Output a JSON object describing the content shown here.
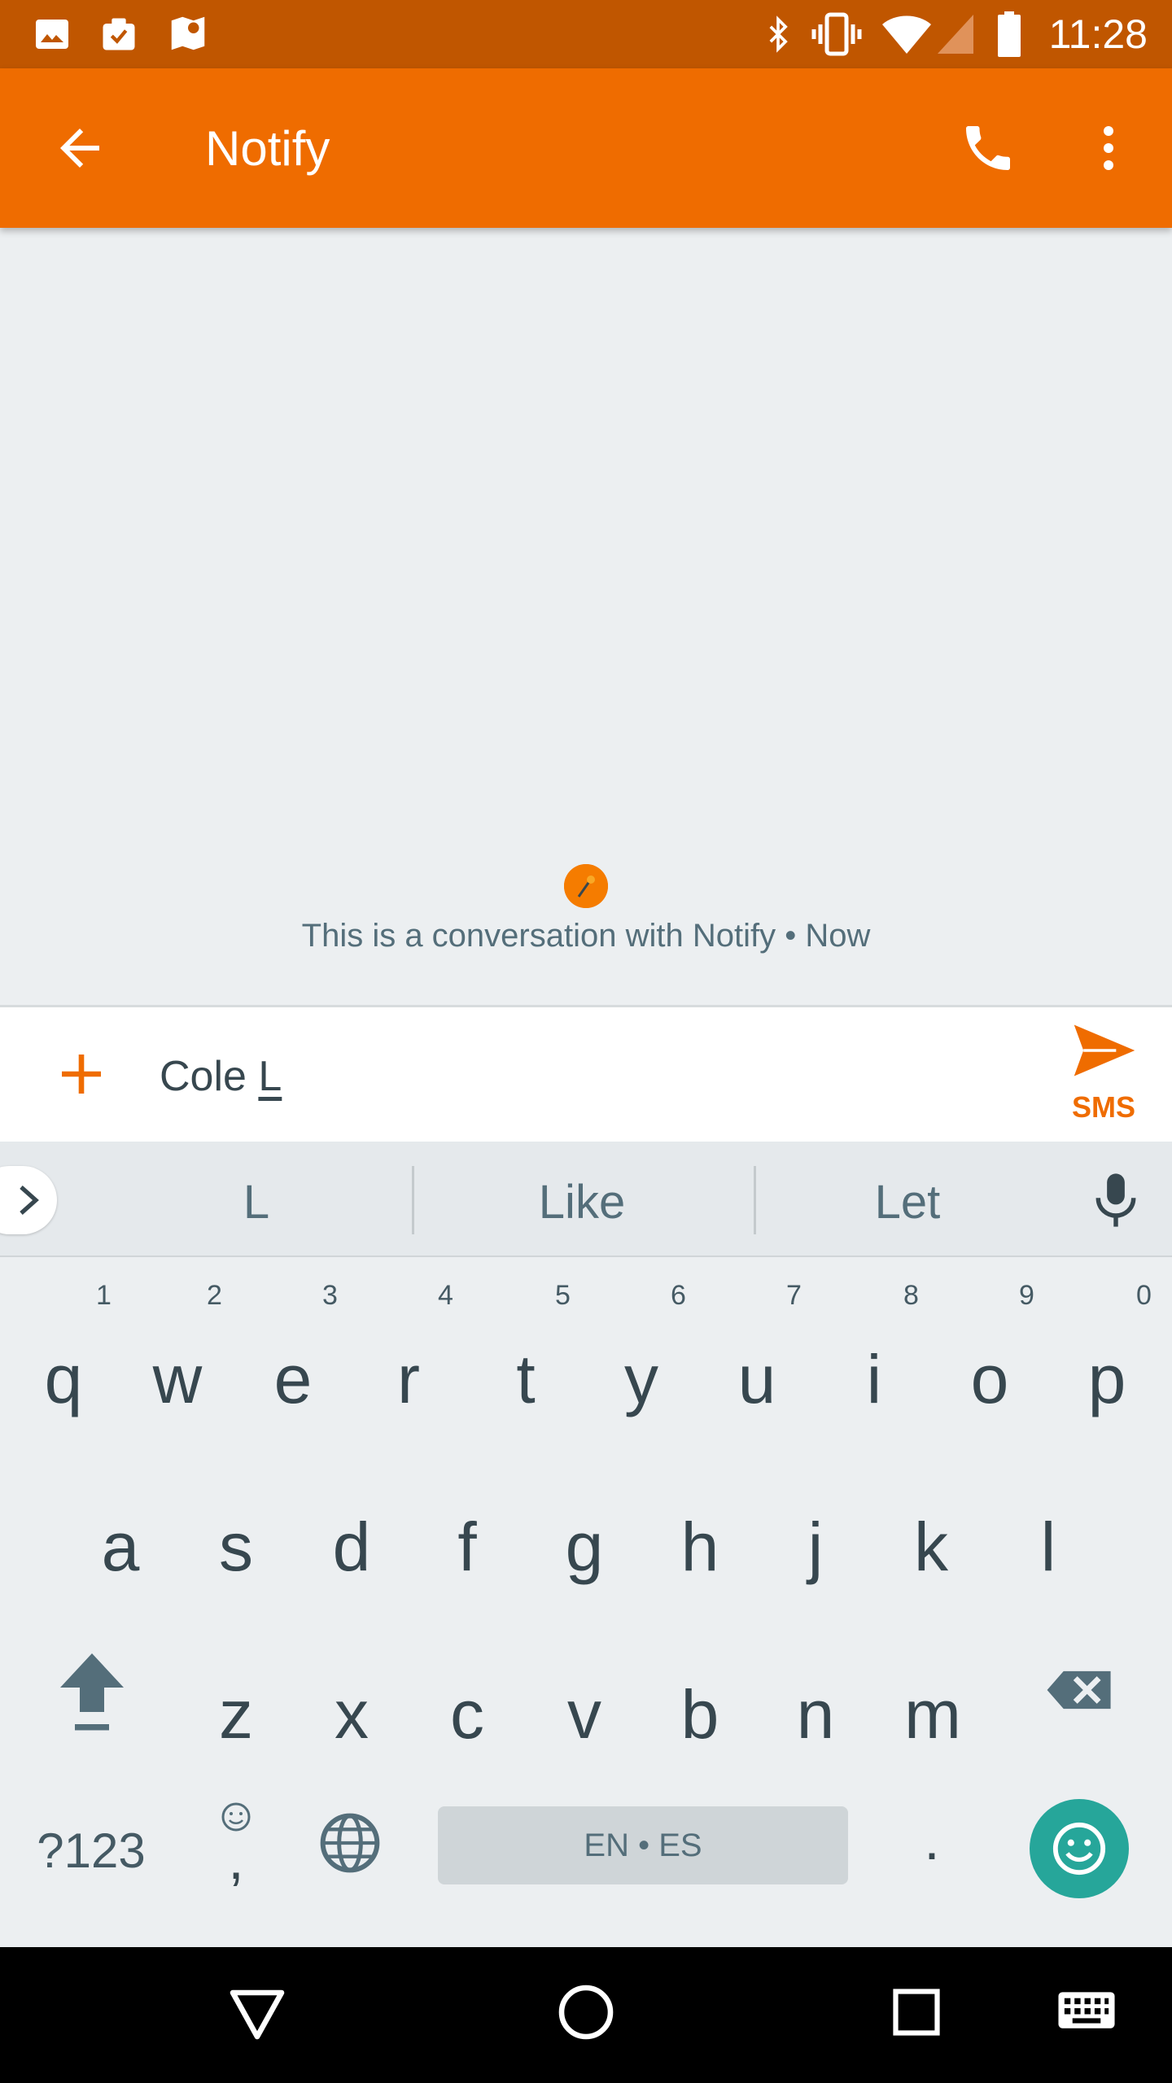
{
  "status_bar": {
    "time": "11:28",
    "left_icons": [
      "image-icon",
      "task-icon",
      "map-icon"
    ],
    "right_icons": [
      "bluetooth-icon",
      "vibrate-icon",
      "wifi-icon",
      "signal-icon",
      "battery-icon"
    ]
  },
  "app_bar": {
    "title": "Notify",
    "back_icon": "arrow-left-icon",
    "call_icon": "phone-icon",
    "menu_icon": "more-vert-icon",
    "color": "#ef6c00"
  },
  "conversation": {
    "info": "This is a conversation with Notify • Now"
  },
  "compose": {
    "text_prefix": "Cole ",
    "text_composing": "L",
    "send_label": "SMS",
    "accent": "#ef6c00"
  },
  "suggestions": [
    "L",
    "Like",
    "Let"
  ],
  "keyboard": {
    "row1": [
      "q",
      "w",
      "e",
      "r",
      "t",
      "y",
      "u",
      "i",
      "o",
      "p"
    ],
    "row1_hints": [
      "1",
      "2",
      "3",
      "4",
      "5",
      "6",
      "7",
      "8",
      "9",
      "0"
    ],
    "row2": [
      "a",
      "s",
      "d",
      "f",
      "g",
      "h",
      "j",
      "k",
      "l"
    ],
    "row3": [
      "z",
      "x",
      "c",
      "v",
      "b",
      "n",
      "m"
    ],
    "symbols_label": "?123",
    "comma_label": ",",
    "space_label": "EN • ES",
    "period_label": ".",
    "emoji_color": "#26a69a"
  },
  "nav_bar": {
    "icons": [
      "back-triangle-icon",
      "home-circle-icon",
      "recents-square-icon",
      "keyboard-icon"
    ]
  }
}
